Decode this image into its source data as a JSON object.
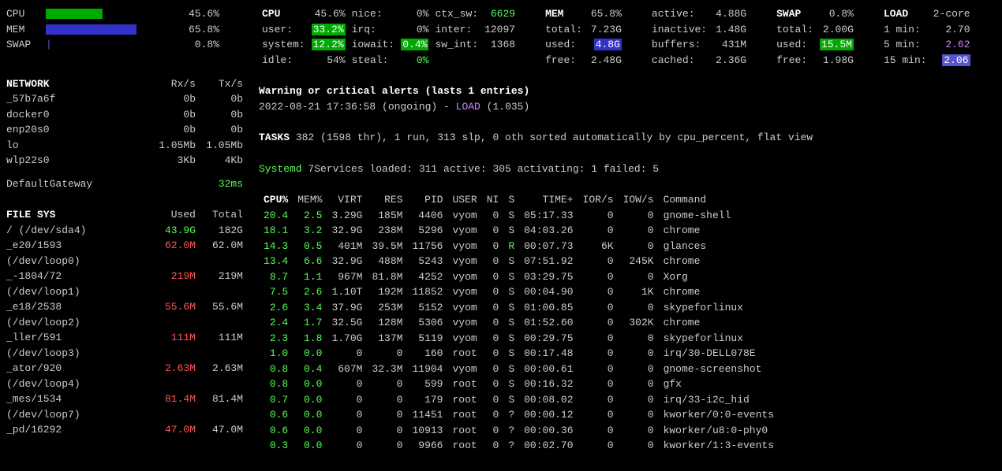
{
  "bars": {
    "cpu": {
      "label": "CPU",
      "pct": "45.6%",
      "width": 72
    },
    "mem": {
      "label": "MEM",
      "pct": "65.8%",
      "width": 115
    },
    "swap": {
      "label": "SWAP",
      "pct": "0.8%",
      "pipe": "|"
    }
  },
  "cpu_detail": {
    "header": "CPU",
    "header_val": "45.6%",
    "rows": [
      {
        "l1": "user:",
        "v1": "33.2%",
        "c1": "bg-green",
        "l2": "irq:",
        "v2": "0%",
        "l3": "inter:",
        "v3": "12097"
      },
      {
        "l1": "system:",
        "v1": "12.2%",
        "c1": "bg-green",
        "l2": "iowait:",
        "v2": "0.4%",
        "c2": "bg-green",
        "l3": "sw_int:",
        "v3": "1368"
      },
      {
        "l1": "idle:",
        "v1": "54%",
        "l2": "steal:",
        "v2": "0%",
        "c2": "green"
      }
    ],
    "nice_label": "nice:",
    "nice_val": "0%",
    "ctx_label": "ctx_sw:",
    "ctx_val": "6629"
  },
  "mem_detail": {
    "header": "MEM",
    "header_val": "65.8%",
    "rows": [
      {
        "l": "total:",
        "v": "7.23G"
      },
      {
        "l": "used:",
        "v": "4.8G",
        "cls": "bg-blue"
      },
      {
        "l": "free:",
        "v": "2.48G"
      }
    ],
    "right": [
      {
        "l": "active:",
        "v": "4.88G"
      },
      {
        "l": "inactive:",
        "v": "1.48G"
      },
      {
        "l": "buffers:",
        "v": "431M"
      },
      {
        "l": "cached:",
        "v": "2.36G"
      }
    ]
  },
  "swap_detail": {
    "header": "SWAP",
    "header_val": "0.8%",
    "rows": [
      {
        "l": "total:",
        "v": "2.00G"
      },
      {
        "l": "used:",
        "v": "15.5M",
        "cls": "bg-green"
      },
      {
        "l": "free:",
        "v": "1.98G"
      }
    ]
  },
  "load_detail": {
    "header": "LOAD",
    "header_val": "2-core",
    "rows": [
      {
        "l": "1 min:",
        "v": "2.70"
      },
      {
        "l": "5 min:",
        "v": "2.62",
        "cls": "purple"
      },
      {
        "l": "15 min:",
        "v": "2.06",
        "cls": "bg-purple"
      }
    ]
  },
  "network": {
    "header": "NETWORK",
    "col1": "Rx/s",
    "col2": "Tx/s",
    "rows": [
      {
        "name": "_57b7a6f",
        "rx": "0b",
        "tx": "0b"
      },
      {
        "name": "docker0",
        "rx": "0b",
        "tx": "0b"
      },
      {
        "name": "enp20s0",
        "rx": "0b",
        "tx": "0b"
      },
      {
        "name": "lo",
        "rx": "1.05Mb",
        "tx": "1.05Mb"
      },
      {
        "name": "wlp22s0",
        "rx": "3Kb",
        "tx": "4Kb"
      }
    ],
    "gateway_label": "DefaultGateway",
    "gateway_val": "32ms"
  },
  "filesys": {
    "header": "FILE SYS",
    "col1": "Used",
    "col2": "Total",
    "rows": [
      {
        "name": "/ (/dev/sda4)",
        "used": "43.9G",
        "total": "182G",
        "cls": "green"
      },
      {
        "name": "_e20/1593",
        "used": "62.0M",
        "total": "62.0M",
        "cls": "red"
      },
      {
        "name": "(/dev/loop0)",
        "used": "",
        "total": ""
      },
      {
        "name": "_-1804/72",
        "used": "219M",
        "total": "219M",
        "cls": "red"
      },
      {
        "name": "(/dev/loop1)",
        "used": "",
        "total": ""
      },
      {
        "name": "_e18/2538",
        "used": "55.6M",
        "total": "55.6M",
        "cls": "red"
      },
      {
        "name": "(/dev/loop2)",
        "used": "",
        "total": ""
      },
      {
        "name": "_ller/591",
        "used": "111M",
        "total": "111M",
        "cls": "red"
      },
      {
        "name": "(/dev/loop3)",
        "used": "",
        "total": ""
      },
      {
        "name": "_ator/920",
        "used": "2.63M",
        "total": "2.63M",
        "cls": "red"
      },
      {
        "name": "(/dev/loop4)",
        "used": "",
        "total": ""
      },
      {
        "name": "_mes/1534",
        "used": "81.4M",
        "total": "81.4M",
        "cls": "red"
      },
      {
        "name": "(/dev/loop7)",
        "used": "",
        "total": ""
      },
      {
        "name": "_pd/16292",
        "used": "47.0M",
        "total": "47.0M",
        "cls": "red"
      }
    ]
  },
  "alert": {
    "title": "Warning or critical alerts (lasts 1 entries)",
    "ts": "2022-08-21 17:36:58 (ongoing) - ",
    "type": "LOAD",
    "val": " (1.035)"
  },
  "tasks": {
    "label": "TASKS",
    "text": " 382 (1598 thr), 1 run, 313 slp, 0 oth sorted automatically by cpu_percent, flat view"
  },
  "systemd": {
    "label": "Systemd",
    "text": "  7Services loaded: 311 active: 305 activating: 1 failed: 5"
  },
  "proc": {
    "headers": [
      "CPU%",
      "MEM%",
      "VIRT",
      "RES",
      "PID",
      "USER",
      "NI",
      "S",
      "TIME+",
      "IOR/s",
      "IOW/s",
      "Command"
    ],
    "rows": [
      {
        "cpu": "20.4",
        "mem": "2.5",
        "virt": "3.29G",
        "res": "185M",
        "pid": "4406",
        "user": "vyom",
        "ni": "0",
        "s": "S",
        "time": "05:17.33",
        "ior": "0",
        "iow": "0",
        "cmd": "gnome-shell"
      },
      {
        "cpu": "18.1",
        "mem": "3.2",
        "virt": "32.9G",
        "res": "238M",
        "pid": "5296",
        "user": "vyom",
        "ni": "0",
        "s": "S",
        "time": "04:03.26",
        "ior": "0",
        "iow": "0",
        "cmd": "chrome"
      },
      {
        "cpu": "14.3",
        "mem": "0.5",
        "virt": "401M",
        "res": "39.5M",
        "pid": "11756",
        "user": "vyom",
        "ni": "0",
        "s": "R",
        "scls": "green",
        "time": "00:07.73",
        "ior": "6K",
        "iow": "0",
        "cmd": "glances"
      },
      {
        "cpu": "13.4",
        "mem": "6.6",
        "virt": "32.9G",
        "res": "488M",
        "pid": "5243",
        "user": "vyom",
        "ni": "0",
        "s": "S",
        "time": "07:51.92",
        "ior": "0",
        "iow": "245K",
        "cmd": "chrome"
      },
      {
        "cpu": "8.7",
        "mem": "1.1",
        "virt": "967M",
        "res": "81.8M",
        "pid": "4252",
        "user": "vyom",
        "ni": "0",
        "s": "S",
        "time": "03:29.75",
        "ior": "0",
        "iow": "0",
        "cmd": "Xorg"
      },
      {
        "cpu": "7.5",
        "mem": "2.6",
        "virt": "1.10T",
        "res": "192M",
        "pid": "11852",
        "user": "vyom",
        "ni": "0",
        "s": "S",
        "time": "00:04.90",
        "ior": "0",
        "iow": "1K",
        "cmd": "chrome"
      },
      {
        "cpu": "2.6",
        "mem": "3.4",
        "virt": "37.9G",
        "res": "253M",
        "pid": "5152",
        "user": "vyom",
        "ni": "0",
        "s": "S",
        "time": "01:00.85",
        "ior": "0",
        "iow": "0",
        "cmd": "skypeforlinux"
      },
      {
        "cpu": "2.4",
        "mem": "1.7",
        "virt": "32.5G",
        "res": "128M",
        "pid": "5306",
        "user": "vyom",
        "ni": "0",
        "s": "S",
        "time": "01:52.60",
        "ior": "0",
        "iow": "302K",
        "cmd": "chrome"
      },
      {
        "cpu": "2.3",
        "mem": "1.8",
        "virt": "1.70G",
        "res": "137M",
        "pid": "5119",
        "user": "vyom",
        "ni": "0",
        "s": "S",
        "time": "00:29.75",
        "ior": "0",
        "iow": "0",
        "cmd": "skypeforlinux"
      },
      {
        "cpu": "1.0",
        "mem": "0.0",
        "virt": "0",
        "res": "0",
        "pid": "160",
        "user": "root",
        "ni": "0",
        "s": "S",
        "time": "00:17.48",
        "ior": "0",
        "iow": "0",
        "cmd": "irq/30-DELL078E"
      },
      {
        "cpu": "0.8",
        "mem": "0.4",
        "virt": "607M",
        "res": "32.3M",
        "pid": "11904",
        "user": "vyom",
        "ni": "0",
        "s": "S",
        "time": "00:00.61",
        "ior": "0",
        "iow": "0",
        "cmd": "gnome-screenshot"
      },
      {
        "cpu": "0.8",
        "mem": "0.0",
        "virt": "0",
        "res": "0",
        "pid": "599",
        "user": "root",
        "ni": "0",
        "s": "S",
        "time": "00:16.32",
        "ior": "0",
        "iow": "0",
        "cmd": "gfx"
      },
      {
        "cpu": "0.7",
        "mem": "0.0",
        "virt": "0",
        "res": "0",
        "pid": "179",
        "user": "root",
        "ni": "0",
        "s": "S",
        "time": "00:08.02",
        "ior": "0",
        "iow": "0",
        "cmd": "irq/33-i2c_hid"
      },
      {
        "cpu": "0.6",
        "mem": "0.0",
        "virt": "0",
        "res": "0",
        "pid": "11451",
        "user": "root",
        "ni": "0",
        "s": "?",
        "time": "00:00.12",
        "ior": "0",
        "iow": "0",
        "cmd": "kworker/0:0-events"
      },
      {
        "cpu": "0.6",
        "mem": "0.0",
        "virt": "0",
        "res": "0",
        "pid": "10913",
        "user": "root",
        "ni": "0",
        "s": "?",
        "time": "00:00.36",
        "ior": "0",
        "iow": "0",
        "cmd": "kworker/u8:0-phy0"
      },
      {
        "cpu": "0.3",
        "mem": "0.0",
        "virt": "0",
        "res": "0",
        "pid": "9966",
        "user": "root",
        "ni": "0",
        "s": "?",
        "time": "00:02.70",
        "ior": "0",
        "iow": "0",
        "cmd": "kworker/1:3-events"
      }
    ]
  }
}
